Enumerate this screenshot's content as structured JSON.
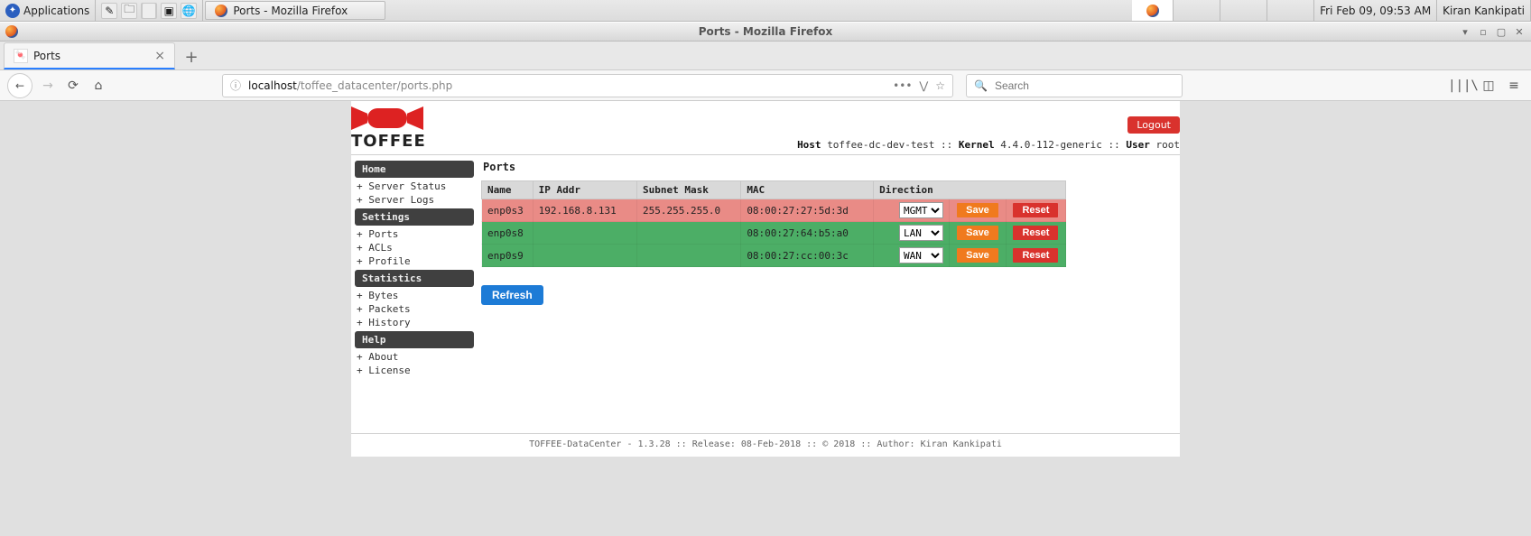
{
  "os_panel": {
    "applications_label": "Applications",
    "taskbar_button": "Ports - Mozilla Firefox",
    "clock": "Fri Feb 09, 09:53 AM",
    "user": "Kiran Kankipati"
  },
  "window": {
    "title": "Ports - Mozilla Firefox"
  },
  "tab": {
    "title": "Ports"
  },
  "url": {
    "host": "localhost",
    "path": "/toffee_datacenter/ports.php"
  },
  "search": {
    "placeholder": "Search"
  },
  "brand": "TOFFEE",
  "header": {
    "logout": "Logout",
    "host_label": "Host",
    "host_value": "toffee-dc-dev-test",
    "kernel_label": "Kernel",
    "kernel_value": "4.4.0-112-generic",
    "user_label": "User",
    "user_value": "root",
    "sep": " :: "
  },
  "sidebar": {
    "groups": [
      {
        "title": "Home",
        "items": [
          "Server Status",
          "Server Logs"
        ]
      },
      {
        "title": "Settings",
        "items": [
          "Ports",
          "ACLs",
          "Profile"
        ]
      },
      {
        "title": "Statistics",
        "items": [
          "Bytes",
          "Packets",
          "History"
        ]
      },
      {
        "title": "Help",
        "items": [
          "About",
          "License"
        ]
      }
    ]
  },
  "main": {
    "heading": "Ports",
    "columns": {
      "name": "Name",
      "ip": "IP Addr",
      "mask": "Subnet Mask",
      "mac": "MAC",
      "dir": "Direction"
    },
    "direction_options": [
      "MGMT",
      "LAN",
      "WAN"
    ],
    "save_label": "Save",
    "reset_label": "Reset",
    "refresh_label": "Refresh",
    "rows": [
      {
        "name": "enp0s3",
        "ip": "192.168.8.131",
        "mask": "255.255.255.0",
        "mac": "08:00:27:27:5d:3d",
        "dir": "MGMT",
        "status": "red"
      },
      {
        "name": "enp0s8",
        "ip": "",
        "mask": "",
        "mac": "08:00:27:64:b5:a0",
        "dir": "LAN",
        "status": "green"
      },
      {
        "name": "enp0s9",
        "ip": "",
        "mask": "",
        "mac": "08:00:27:cc:00:3c",
        "dir": "WAN",
        "status": "green"
      }
    ]
  },
  "footer": "TOFFEE-DataCenter - 1.3.28 :: Release: 08-Feb-2018 :: © 2018 :: Author: Kiran Kankipati"
}
